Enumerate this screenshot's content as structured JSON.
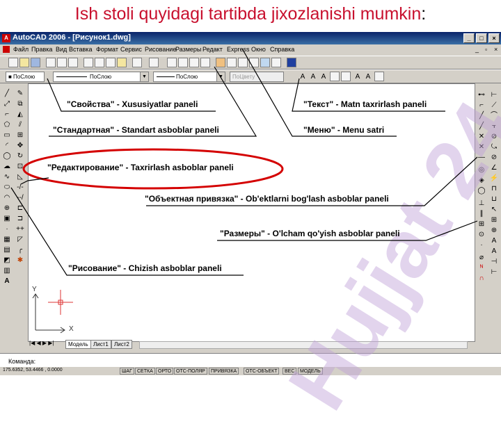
{
  "slide": {
    "title": "Ish stoli quyidagi tartibda jixozlanishi mumkin",
    "title_colon": ":"
  },
  "window": {
    "title": "AutoCAD 2006 - [Рисунок1.dwg]"
  },
  "menu": {
    "items": [
      "Файл",
      "Правка",
      "Вид",
      "Вставка",
      "Формат",
      "Сервис",
      "Рисование",
      "Размеры",
      "Редакт",
      "Express",
      "Окно",
      "Справка"
    ]
  },
  "properties": {
    "layer": "■ ПоСлою",
    "linetype": "ПоСлою",
    "lineweight": "ПоСлою",
    "plotstyle": "ПоЦвету"
  },
  "tabs": [
    "Модель",
    "Лист1",
    "Лист2"
  ],
  "command": {
    "prompt": "Команда:"
  },
  "status": {
    "coords": "175.6352, 53.4466 , 0.0000",
    "toggles": [
      "ШАГ",
      "СЕТКА",
      "ОРТО",
      "ОТС-ПОЛЯР",
      "ПРИВЯЗКА",
      "ОТС-ОБЪЕКТ",
      "ВЕС",
      "МОДЕЛЬ"
    ]
  },
  "callouts": {
    "properties": "\"Свойства\" - Xususiyatlar paneli",
    "standard": "\"Стандартная\" - Standart asboblar  paneli",
    "modify": "\"Редактирование\" - Taxrirlash asboblar paneli",
    "draw": "\"Рисование\" - Chizish asboblar paneli",
    "text": "\"Текст\" - Matn taxrirlash paneli",
    "menu": "\"Меню\" - Menu satri",
    "osnap": "\"Объектная привязка\" - Ob'ektlarni bog'lash asboblar paneli",
    "dimension": "\"Размеры\" - O'lcham qo'yish asboblar paneli"
  },
  "ucs": {
    "x": "X",
    "y": "Y"
  },
  "watermark": "Hujjat 24",
  "colors": {
    "title_red": "#c8102e",
    "ellipse_red": "#d40000",
    "titlebar_blue": "#0a246a"
  }
}
